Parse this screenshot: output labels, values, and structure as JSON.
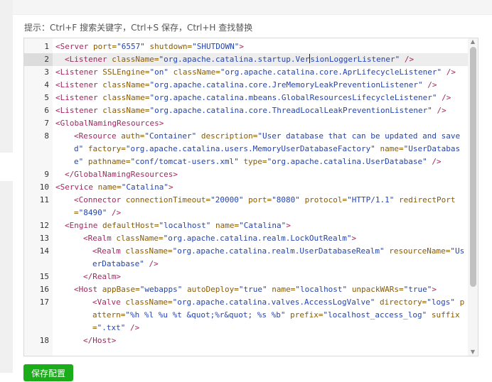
{
  "hint": "提示：Ctrl+F 搜索关键字，Ctrl+S 保存，Ctrl+H 查找替换",
  "save_button": "保存配置",
  "editor": {
    "active_line": 2,
    "lines": [
      {
        "n": "1",
        "indent": 0,
        "tokens": [
          [
            "tag",
            "<Server"
          ],
          [
            "sp",
            " "
          ],
          [
            "attr",
            "port="
          ],
          [
            "val",
            "\"6557\""
          ],
          [
            "sp",
            " "
          ],
          [
            "attr",
            "shutdown="
          ],
          [
            "val",
            "\"SHUTDOWN\""
          ],
          [
            "tag",
            ">"
          ]
        ]
      },
      {
        "n": "2",
        "indent": 1,
        "tokens": [
          [
            "tag",
            "<Listener"
          ],
          [
            "sp",
            " "
          ],
          [
            "attr",
            "className="
          ],
          [
            "val",
            "\"org.apache.catalina.startup.Ver"
          ],
          [
            "caret",
            ""
          ],
          [
            "val",
            "sionLoggerListener\""
          ],
          [
            "sp",
            " "
          ],
          [
            "tag",
            "/>"
          ]
        ]
      },
      {
        "n": "3",
        "indent": 0,
        "tokens": [
          [
            "tag",
            "<Listener"
          ],
          [
            "sp",
            " "
          ],
          [
            "attr",
            "SSLEngine="
          ],
          [
            "val",
            "\"on\""
          ],
          [
            "sp",
            " "
          ],
          [
            "attr",
            "className="
          ],
          [
            "val",
            "\"org.apache.catalina.core.AprLifecycleListener\""
          ],
          [
            "sp",
            " "
          ],
          [
            "tag",
            "/>"
          ]
        ]
      },
      {
        "n": "4",
        "indent": 0,
        "tokens": [
          [
            "tag",
            "<Listener"
          ],
          [
            "sp",
            " "
          ],
          [
            "attr",
            "className="
          ],
          [
            "val",
            "\"org.apache.catalina.core.JreMemoryLeakPreventionListener\""
          ],
          [
            "sp",
            " "
          ],
          [
            "tag",
            "/>"
          ]
        ]
      },
      {
        "n": "5",
        "indent": 0,
        "tokens": [
          [
            "tag",
            "<Listener"
          ],
          [
            "sp",
            " "
          ],
          [
            "attr",
            "className="
          ],
          [
            "val",
            "\"org.apache.catalina.mbeans.GlobalResourcesLifecycleListener\""
          ],
          [
            "sp",
            " "
          ],
          [
            "tag",
            "/>"
          ]
        ]
      },
      {
        "n": "6",
        "indent": 0,
        "tokens": [
          [
            "tag",
            "<Listener"
          ],
          [
            "sp",
            " "
          ],
          [
            "attr",
            "className="
          ],
          [
            "val",
            "\"org.apache.catalina.core.ThreadLocalLeakPreventionListener\""
          ],
          [
            "sp",
            " "
          ],
          [
            "tag",
            "/>"
          ]
        ]
      },
      {
        "n": "7",
        "indent": 0,
        "tokens": [
          [
            "tag",
            "<GlobalNamingResources>"
          ]
        ]
      },
      {
        "n": "8",
        "indent": 2,
        "tokens": [
          [
            "tag",
            "<Resource"
          ],
          [
            "sp",
            " "
          ],
          [
            "attr",
            "auth="
          ],
          [
            "val",
            "\"Container\""
          ],
          [
            "sp",
            " "
          ],
          [
            "attr",
            "description="
          ],
          [
            "val",
            "\"User database that can be updated and saved\""
          ],
          [
            "sp",
            " "
          ],
          [
            "attr",
            "factory="
          ],
          [
            "val",
            "\"org.apache.catalina.users.MemoryUserDatabaseFactory\""
          ],
          [
            "sp",
            " "
          ],
          [
            "attr",
            "name="
          ],
          [
            "val",
            "\"UserDatabase\""
          ],
          [
            "sp",
            " "
          ],
          [
            "attr",
            "pathname="
          ],
          [
            "val",
            "\"conf/tomcat-users.xml\""
          ],
          [
            "sp",
            " "
          ],
          [
            "attr",
            "type="
          ],
          [
            "val",
            "\"org.apache.catalina.UserDatabase\""
          ],
          [
            "sp",
            " "
          ],
          [
            "tag",
            "/>"
          ]
        ]
      },
      {
        "n": "9",
        "indent": 1,
        "tokens": [
          [
            "tag",
            "</GlobalNamingResources>"
          ]
        ]
      },
      {
        "n": "10",
        "indent": 0,
        "tokens": [
          [
            "tag",
            "<Service"
          ],
          [
            "sp",
            " "
          ],
          [
            "attr",
            "name="
          ],
          [
            "val",
            "\"Catalina\""
          ],
          [
            "tag",
            ">"
          ]
        ]
      },
      {
        "n": "11",
        "indent": 2,
        "tokens": [
          [
            "tag",
            "<Connector"
          ],
          [
            "sp",
            " "
          ],
          [
            "attr",
            "connectionTimeout="
          ],
          [
            "val",
            "\"20000\""
          ],
          [
            "sp",
            " "
          ],
          [
            "attr",
            "port="
          ],
          [
            "val",
            "\"8080\""
          ],
          [
            "sp",
            " "
          ],
          [
            "attr",
            "protocol="
          ],
          [
            "val",
            "\"HTTP/1.1\""
          ],
          [
            "sp",
            " "
          ],
          [
            "attr",
            "redirectPort="
          ],
          [
            "val",
            "\"8490\""
          ],
          [
            "sp",
            " "
          ],
          [
            "tag",
            "/>"
          ]
        ]
      },
      {
        "n": "12",
        "indent": 1,
        "tokens": [
          [
            "tag",
            "<Engine"
          ],
          [
            "sp",
            " "
          ],
          [
            "attr",
            "defaultHost="
          ],
          [
            "val",
            "\"localhost\""
          ],
          [
            "sp",
            " "
          ],
          [
            "attr",
            "name="
          ],
          [
            "val",
            "\"Catalina\""
          ],
          [
            "tag",
            ">"
          ]
        ]
      },
      {
        "n": "13",
        "indent": 3,
        "tokens": [
          [
            "tag",
            "<Realm"
          ],
          [
            "sp",
            " "
          ],
          [
            "attr",
            "className="
          ],
          [
            "val",
            "\"org.apache.catalina.realm.LockOutRealm\""
          ],
          [
            "tag",
            ">"
          ]
        ]
      },
      {
        "n": "14",
        "indent": 4,
        "tokens": [
          [
            "tag",
            "<Realm"
          ],
          [
            "sp",
            " "
          ],
          [
            "attr",
            "className="
          ],
          [
            "val",
            "\"org.apache.catalina.realm.UserDatabaseRealm\""
          ],
          [
            "sp",
            " "
          ],
          [
            "attr",
            "resourceName="
          ],
          [
            "val",
            "\"UserDatabase\""
          ],
          [
            "sp",
            " "
          ],
          [
            "tag",
            "/>"
          ]
        ]
      },
      {
        "n": "15",
        "indent": 3,
        "tokens": [
          [
            "tag",
            "</Realm>"
          ]
        ]
      },
      {
        "n": "16",
        "indent": 2,
        "tokens": [
          [
            "tag",
            "<Host"
          ],
          [
            "sp",
            " "
          ],
          [
            "attr",
            "appBase="
          ],
          [
            "val",
            "\"webapps\""
          ],
          [
            "sp",
            " "
          ],
          [
            "attr",
            "autoDeploy="
          ],
          [
            "val",
            "\"true\""
          ],
          [
            "sp",
            " "
          ],
          [
            "attr",
            "name="
          ],
          [
            "val",
            "\"localhost\""
          ],
          [
            "sp",
            " "
          ],
          [
            "attr",
            "unpackWARs="
          ],
          [
            "val",
            "\"true\""
          ],
          [
            "tag",
            ">"
          ]
        ]
      },
      {
        "n": "17",
        "indent": 4,
        "tokens": [
          [
            "tag",
            "<Valve"
          ],
          [
            "sp",
            " "
          ],
          [
            "attr",
            "className="
          ],
          [
            "val",
            "\"org.apache.catalina.valves.AccessLogValve\""
          ],
          [
            "sp",
            " "
          ],
          [
            "attr",
            "directory="
          ],
          [
            "val",
            "\"logs\""
          ],
          [
            "sp",
            " "
          ],
          [
            "attr",
            "pattern="
          ],
          [
            "val",
            "\"%h %l %u %t &quot;%r&quot; %s %b\""
          ],
          [
            "sp",
            " "
          ],
          [
            "attr",
            "prefix="
          ],
          [
            "val",
            "\"localhost_access_log\""
          ],
          [
            "sp",
            " "
          ],
          [
            "attr",
            "suffix="
          ],
          [
            "val",
            "\".txt\""
          ],
          [
            "sp",
            " "
          ],
          [
            "tag",
            "/>"
          ]
        ]
      },
      {
        "n": "18",
        "indent": 3,
        "tokens": [
          [
            "tag",
            "</Host>"
          ]
        ]
      }
    ]
  }
}
